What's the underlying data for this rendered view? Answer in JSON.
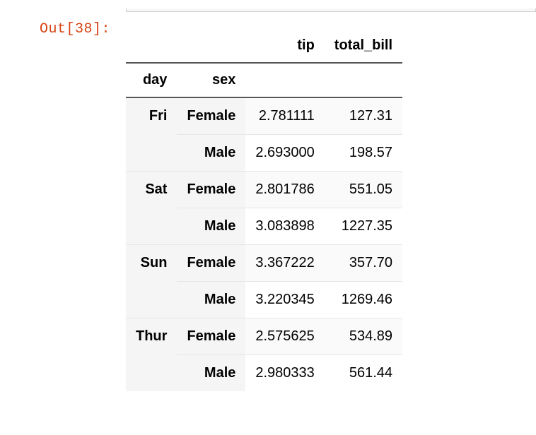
{
  "prompt": "Out[38]:",
  "columns": [
    "tip",
    "total_bill"
  ],
  "index_names": [
    "day",
    "sex"
  ],
  "rows": [
    {
      "day": "Fri",
      "sex": "Female",
      "tip": "2.781111",
      "total_bill": "127.31"
    },
    {
      "day": "",
      "sex": "Male",
      "tip": "2.693000",
      "total_bill": "198.57"
    },
    {
      "day": "Sat",
      "sex": "Female",
      "tip": "2.801786",
      "total_bill": "551.05"
    },
    {
      "day": "",
      "sex": "Male",
      "tip": "3.083898",
      "total_bill": "1227.35"
    },
    {
      "day": "Sun",
      "sex": "Female",
      "tip": "3.367222",
      "total_bill": "357.70"
    },
    {
      "day": "",
      "sex": "Male",
      "tip": "3.220345",
      "total_bill": "1269.46"
    },
    {
      "day": "Thur",
      "sex": "Female",
      "tip": "2.575625",
      "total_bill": "534.89"
    },
    {
      "day": "",
      "sex": "Male",
      "tip": "2.980333",
      "total_bill": "561.44"
    }
  ]
}
